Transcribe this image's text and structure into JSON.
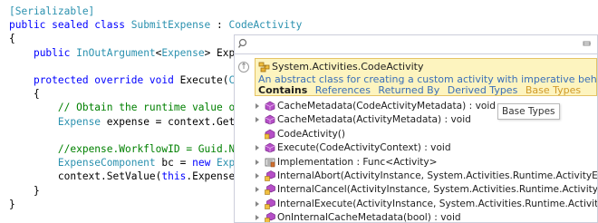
{
  "code": {
    "lines": [
      {
        "parts": [
          {
            "c": "at",
            "t": "[Serializable]"
          }
        ]
      },
      {
        "parts": [
          {
            "c": "kw",
            "t": "public sealed class "
          },
          {
            "c": "ty",
            "t": "SubmitExpense"
          },
          {
            "c": "",
            "t": " : "
          },
          {
            "c": "ty",
            "t": "CodeActivity"
          }
        ]
      },
      {
        "parts": [
          {
            "c": "",
            "t": "{"
          }
        ]
      },
      {
        "parts": [
          {
            "c": "",
            "t": "    "
          },
          {
            "c": "kw",
            "t": "public "
          },
          {
            "c": "ty",
            "t": "InOutArgument"
          },
          {
            "c": "",
            "t": "<"
          },
          {
            "c": "ty",
            "t": "Expense"
          },
          {
            "c": "",
            "t": "> Expense"
          }
        ]
      },
      {
        "parts": [
          {
            "c": "",
            "t": ""
          }
        ]
      },
      {
        "parts": [
          {
            "c": "",
            "t": "    "
          },
          {
            "c": "kw",
            "t": "protected override void "
          },
          {
            "c": "",
            "t": "Execute("
          },
          {
            "c": "ty",
            "t": "CodeAc"
          }
        ]
      },
      {
        "parts": [
          {
            "c": "",
            "t": "    {"
          }
        ]
      },
      {
        "parts": [
          {
            "c": "",
            "t": "        "
          },
          {
            "c": "cm",
            "t": "// Obtain the runtime value of the"
          }
        ]
      },
      {
        "parts": [
          {
            "c": "",
            "t": "        "
          },
          {
            "c": "ty",
            "t": "Expense"
          },
          {
            "c": "",
            "t": " expense = context.GetValue"
          }
        ]
      },
      {
        "parts": [
          {
            "c": "",
            "t": ""
          }
        ]
      },
      {
        "parts": [
          {
            "c": "",
            "t": "        "
          },
          {
            "c": "cm",
            "t": "//expense.WorkflowID = Guid.NewGui"
          }
        ]
      },
      {
        "parts": [
          {
            "c": "",
            "t": "        "
          },
          {
            "c": "ty",
            "t": "ExpenseComponent"
          },
          {
            "c": "",
            "t": " bc = "
          },
          {
            "c": "kw",
            "t": "new "
          },
          {
            "c": "ty",
            "t": "ExpenseC"
          }
        ]
      },
      {
        "parts": [
          {
            "c": "",
            "t": "        context.SetValue("
          },
          {
            "c": "kw",
            "t": "this"
          },
          {
            "c": "",
            "t": ".Expense, bc."
          }
        ]
      },
      {
        "parts": [
          {
            "c": "",
            "t": "    }"
          }
        ]
      },
      {
        "parts": [
          {
            "c": "",
            "t": "}"
          }
        ]
      }
    ]
  },
  "popup": {
    "search": {
      "value": "",
      "placeholder": ""
    },
    "back_symbol": "↑",
    "selected": {
      "title": "System.Activities.CodeActivity",
      "description": "An abstract class for creating a custom activity with imperative behavior define...",
      "tabs": [
        "Contains",
        "References",
        "Returned By",
        "Derived Types",
        "Base Types"
      ]
    },
    "tooltip": "Base Types",
    "members": [
      {
        "label": "CacheMetadata(CodeActivityMetadata) : void",
        "icon": "method-icon",
        "expandable": true
      },
      {
        "label": "CacheMetadata(ActivityMetadata) : void",
        "icon": "method-icon",
        "expandable": true
      },
      {
        "label": "CodeActivity()",
        "icon": "constructor-icon",
        "expandable": false
      },
      {
        "label": "Execute(CodeActivityContext) : void",
        "icon": "method-icon",
        "expandable": true
      },
      {
        "label": "Implementation : Func<Activity>",
        "icon": "property-icon",
        "expandable": true
      },
      {
        "label": "InternalAbort(ActivityInstance, System.Activities.Runtime.ActivityExecutor, Exc",
        "icon": "protected-method-icon",
        "expandable": true
      },
      {
        "label": "InternalCancel(ActivityInstance, System.Activities.Runtime.ActivityExecutor, Sy",
        "icon": "protected-method-icon",
        "expandable": true
      },
      {
        "label": "InternalExecute(ActivityInstance, System.Activities.Runtime.ActivityExecutor, Sy",
        "icon": "protected-method-icon",
        "expandable": true
      },
      {
        "label": "OnInternalCacheMetadata(bool) : void",
        "icon": "protected-method-icon",
        "expandable": true
      }
    ]
  }
}
